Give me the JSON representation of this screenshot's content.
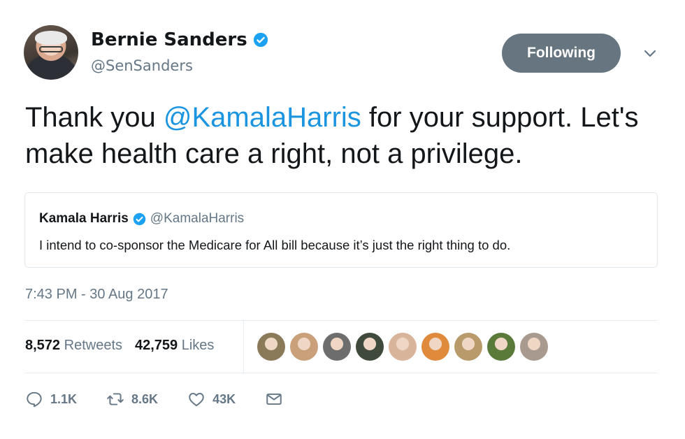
{
  "author": {
    "name": "Bernie Sanders",
    "handle": "@SenSanders",
    "verified": true
  },
  "follow_button": {
    "label": "Following"
  },
  "tweet": {
    "text_before": "Thank you ",
    "mention": "@KamalaHarris",
    "text_after": " for your support. Let's make health care a right, not a privilege."
  },
  "quoted_tweet": {
    "name": "Kamala Harris",
    "handle": "@KamalaHarris",
    "verified": true,
    "text": "I intend to co-sponsor the Medicare for All bill because it’s just the right thing to do."
  },
  "timestamp": "7:43 PM - 30 Aug 2017",
  "stats": {
    "retweets_count": "8,572",
    "retweets_label": "Retweets",
    "likes_count": "42,759",
    "likes_label": "Likes"
  },
  "likers": [
    {
      "name": "liker-1",
      "color": "#8a7a5a"
    },
    {
      "name": "liker-2",
      "color": "#c9a07a"
    },
    {
      "name": "liker-3",
      "color": "#6d6d6d"
    },
    {
      "name": "liker-4",
      "color": "#3f4a3c"
    },
    {
      "name": "liker-5",
      "color": "#d8b49a"
    },
    {
      "name": "liker-6",
      "color": "#e08a3c"
    },
    {
      "name": "liker-7",
      "color": "#b99b6b"
    },
    {
      "name": "liker-8",
      "color": "#5a7a3a"
    },
    {
      "name": "liker-9",
      "color": "#a99a90"
    }
  ],
  "actions": {
    "reply_count": "1.1K",
    "retweet_count": "8.6K",
    "like_count": "43K"
  },
  "colors": {
    "link": "#1b95e0",
    "secondary": "#657786",
    "following_button": "#66757f",
    "verified_badge": "#1da1f2"
  }
}
